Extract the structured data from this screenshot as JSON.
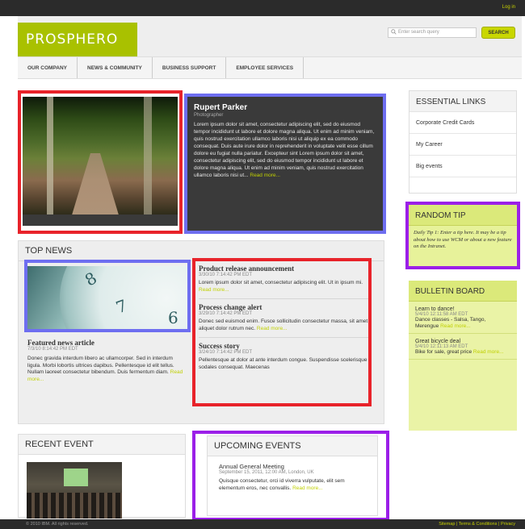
{
  "topbar": {
    "login": "Log in"
  },
  "header": {
    "logo": "PROSPHERO",
    "search_placeholder": "Enter search query",
    "search_button": "SEARCH"
  },
  "nav": [
    "OUR COMPANY",
    "NEWS & COMMUNITY",
    "BUSINESS SUPPORT",
    "EMPLOYEE SERVICES"
  ],
  "profile": {
    "name": "Rupert Parker",
    "role": "Photographer",
    "body": "Lorem ipsum dolor sit amet, consectetur adipiscing elit, sed do eiusmod tempor incididunt ut labore et dolore magna aliqua. Ut enim ad minim veniam, quis nostrud exercitation ullamco laboris nisi ut aliquip ex ea commodo consequat. Duis aute irure dolor in reprehenderit in voluptate velit esse cillum dolore eu fugiat nulla pariatur. Excepteur sint Lorem ipsum dolor sit amet, consectetur adipiscing elit, sed do eiusmod tempor incididunt ut labore et dolore magna aliqua. Ut enim ad minim veniam, quis nostrud exercitation ullamco laboris nisi ut...",
    "read_more": "Read more..."
  },
  "essential_links": {
    "title": "ESSENTIAL LINKS",
    "items": [
      "Corporate Credit Cards",
      "My Career",
      "Big events"
    ]
  },
  "random_tip": {
    "title": "RANDOM TIP",
    "text": "Daily Tip 1: Enter a tip here. It may be a tip about how to use WCM or about a new feature on the Intranet."
  },
  "bulletin": {
    "title": "BULLETIN BOARD",
    "items": [
      {
        "title": "Learn to dance!",
        "date": "5/4/10 12:11:58 AM EDT",
        "body": "Dance classes - Salsa, Tango, Merengue",
        "more": "Read more..."
      },
      {
        "title": "Great bicycle deal",
        "date": "5/4/10 12:11:13 AM EDT",
        "body": "Bike for sale, great price",
        "more": "Read more..."
      }
    ]
  },
  "top_news": {
    "title": "TOP NEWS",
    "featured": {
      "title": "Featured news article",
      "date": "7/3/10 8:14:42 PM EDT",
      "body": "Donec gravida interdum libero ac ullamcorper. Sed in interdum ligula. Morbi lobortis ultrices dapibus. Pellentesque id elit tellus. Nullam laoreet consectetur bibendum. Duis fermentum diam.",
      "more": "Read more..."
    },
    "items": [
      {
        "title": "Product release announcement",
        "date": "3/30/10 7:14:42 PM EDT",
        "body": "Lorem ipsum dolor sit amet, consectetur adipiscing elit. Ut in ipsum mi.",
        "more": "Read more..."
      },
      {
        "title": "Process change alert",
        "date": "3/29/10 7:14:42 PM EDT",
        "body": "Donec sed euismod enim. Fusce sollicitudin consectetur massa, sit amet aliquet dolor rutrum nec.",
        "more": "Read more..."
      },
      {
        "title": "Success story",
        "date": "3/24/10 7:14:42 PM EDT",
        "body": "Pellentesque at dolor at ante interdum congue. Suspendisse scelerisque sodales consequat. Maecenas",
        "more": ""
      }
    ]
  },
  "recent_event": {
    "title": "RECENT EVENT"
  },
  "upcoming_events": {
    "title": "UPCOMING EVENTS",
    "event_title": "Annual General Meeting",
    "event_date": "September 15, 2011, 12:00 AM, London, UK",
    "body": "Quisque consectetur, orci id viverra vulputate, elit sem elementum eros, nec convallis.",
    "more": "Read more..."
  },
  "footer": {
    "copyright": "© 2010 IBM. All rights reserved.",
    "links": "Sitemap | Terms & Conditions | Privacy"
  },
  "colors": {
    "brand": "#a9c100",
    "highlight_red": "#e8232a",
    "highlight_blue": "#6e6ef0",
    "highlight_purple": "#9b1fe8"
  }
}
